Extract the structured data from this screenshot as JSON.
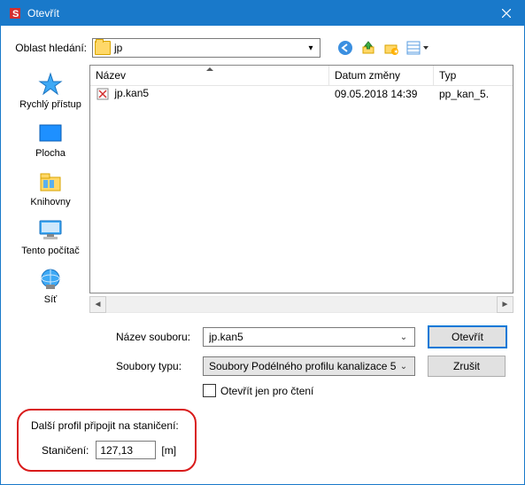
{
  "window": {
    "title": "Otevřít"
  },
  "search": {
    "label": "Oblast hledání:",
    "folder": "jp"
  },
  "nav_icons": {
    "back": "back-icon",
    "up": "up-icon",
    "newfolder": "new-folder-icon",
    "views": "views-icon"
  },
  "sidebar": {
    "items": [
      {
        "label": "Rychlý přístup",
        "icon": "quick-access-icon"
      },
      {
        "label": "Plocha",
        "icon": "desktop-icon"
      },
      {
        "label": "Knihovny",
        "icon": "libraries-icon"
      },
      {
        "label": "Tento počítač",
        "icon": "this-pc-icon"
      },
      {
        "label": "Síť",
        "icon": "network-icon"
      }
    ]
  },
  "filelist": {
    "columns": {
      "name": "Název",
      "date": "Datum změny",
      "type": "Typ"
    },
    "rows": [
      {
        "name": "jp.kan5",
        "date": "09.05.2018 14:39",
        "type": "pp_kan_5."
      }
    ]
  },
  "controls": {
    "filename_label": "Název souboru:",
    "filename_value": "jp.kan5",
    "filetype_label": "Soubory typu:",
    "filetype_value": "Soubory Podélného profilu kanalizace 5",
    "readonly_label": "Otevřít jen pro čtení",
    "open_btn": "Otevřít",
    "cancel_btn": "Zrušit"
  },
  "bottom": {
    "title": "Další profil připojit na staničení:",
    "label": "Staničení:",
    "value": "127,13",
    "unit": "[m]"
  }
}
